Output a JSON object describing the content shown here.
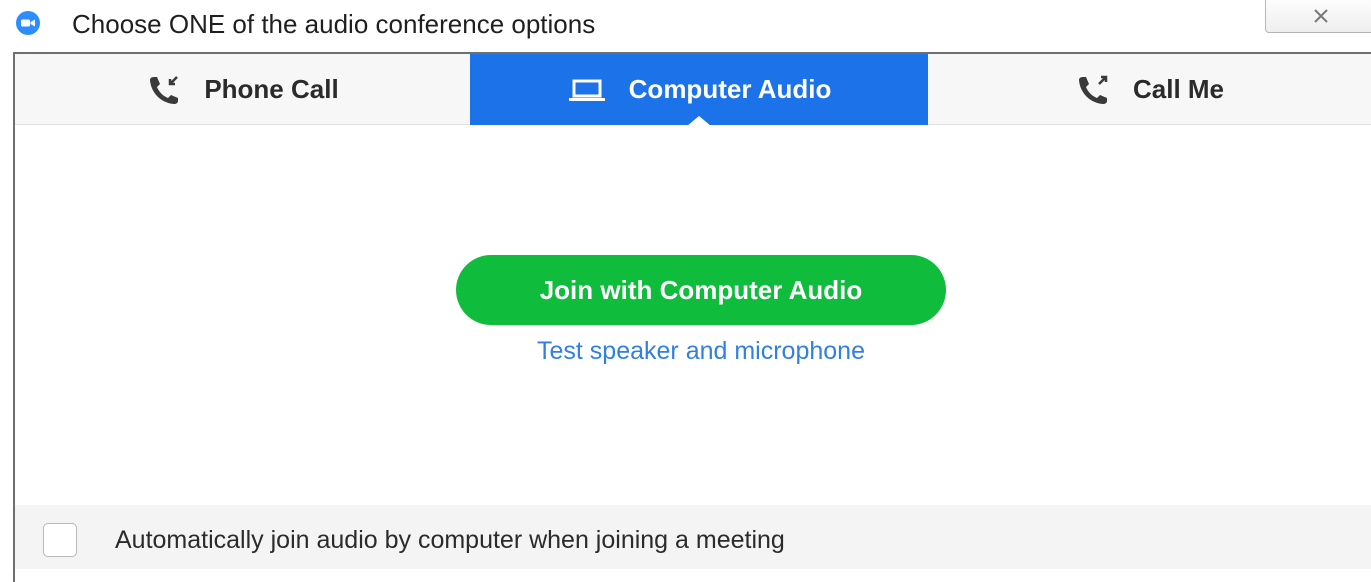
{
  "window": {
    "title": "Choose ONE of the audio conference options",
    "logo_icon": "zoom-logo-icon",
    "close_icon": "close-icon"
  },
  "tabs": [
    {
      "label": "Phone Call",
      "icon": "phone-incoming-icon",
      "active": false
    },
    {
      "label": "Computer Audio",
      "icon": "laptop-icon",
      "active": true
    },
    {
      "label": "Call Me",
      "icon": "phone-outgoing-icon",
      "active": false
    }
  ],
  "main": {
    "join_button_label": "Join with Computer Audio",
    "test_link_label": "Test speaker and microphone"
  },
  "footer": {
    "auto_join_label": "Automatically join audio by computer when joining a meeting",
    "auto_join_checked": false
  },
  "colors": {
    "accent_blue": "#1c72e8",
    "join_green": "#0fbc3c",
    "link_blue": "#2f80e0"
  }
}
